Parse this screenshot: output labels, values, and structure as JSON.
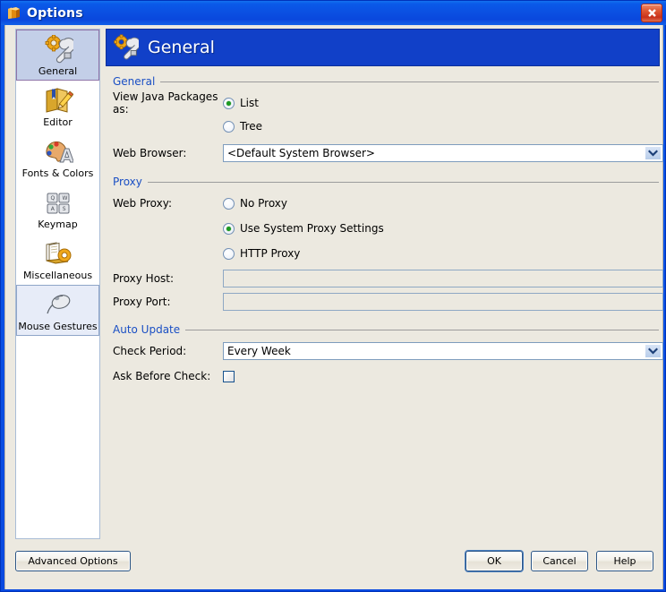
{
  "window": {
    "title": "Options",
    "title_icon": "book-icon",
    "close_icon": "close-icon"
  },
  "sidebar": {
    "items": [
      {
        "label": "General",
        "icon": "gear-wrench-icon",
        "state": "selected"
      },
      {
        "label": "Editor",
        "icon": "book-pencil-icon",
        "state": "normal"
      },
      {
        "label": "Fonts & Colors",
        "icon": "palette-letter-icon",
        "state": "normal"
      },
      {
        "label": "Keymap",
        "icon": "keyboard-icon",
        "state": "normal"
      },
      {
        "label": "Miscellaneous",
        "icon": "papers-gear-icon",
        "state": "normal"
      },
      {
        "label": "Mouse Gestures",
        "icon": "mouse-icon",
        "state": "hover"
      }
    ]
  },
  "banner": {
    "title": "General",
    "icon": "gear-wrench-icon",
    "color": "#1140c8"
  },
  "sections": {
    "general": {
      "title": "General",
      "view_packages": {
        "label": "View Java Packages as:",
        "options": [
          {
            "label": "List",
            "selected": true
          },
          {
            "label": "Tree",
            "selected": false
          }
        ]
      },
      "web_browser": {
        "label": "Web Browser:",
        "value": "<Default System Browser>"
      }
    },
    "proxy": {
      "title": "Proxy",
      "web_proxy": {
        "label": "Web Proxy:",
        "options": [
          {
            "label": "No Proxy",
            "selected": false
          },
          {
            "label": "Use System Proxy Settings",
            "selected": true
          },
          {
            "label": "HTTP Proxy",
            "selected": false
          }
        ]
      },
      "proxy_host": {
        "label": "Proxy Host:",
        "value": "",
        "disabled": true
      },
      "proxy_port": {
        "label": "Proxy Port:",
        "value": "",
        "disabled": true
      }
    },
    "auto_update": {
      "title": "Auto Update",
      "check_period": {
        "label": "Check Period:",
        "value": "Every Week"
      },
      "ask_before_check": {
        "label": "Ask Before Check:",
        "checked": false
      }
    }
  },
  "buttons": {
    "advanced": "Advanced Options",
    "ok": "OK",
    "cancel": "Cancel",
    "help": "Help"
  },
  "colors": {
    "title_bar": "#0b50e2",
    "banner": "#1140c8",
    "section_text": "#1a4fc4",
    "content_bg": "#ece9e0",
    "radio_dot": "#1d9a22"
  }
}
